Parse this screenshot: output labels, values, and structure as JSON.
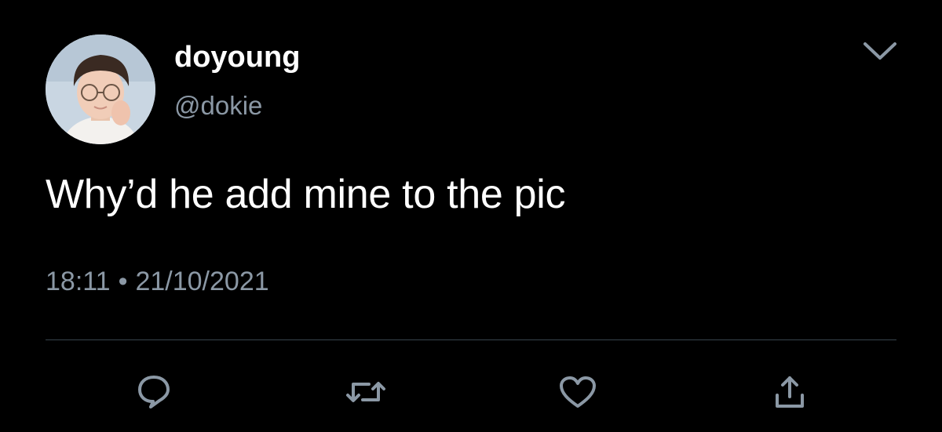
{
  "user": {
    "display_name": "doyoung",
    "handle": "@dokie",
    "avatar_icon": "profile-photo"
  },
  "tweet": {
    "text": "Why’d he add mine to the pic",
    "time": "18:11",
    "separator": "•",
    "date": "21/10/2021"
  },
  "actions": {
    "reply_icon": "reply-icon",
    "retweet_icon": "retweet-icon",
    "like_icon": "heart-icon",
    "share_icon": "share-icon",
    "menu_icon": "chevron-down-icon"
  },
  "colors": {
    "background": "#000000",
    "primary_text": "#ffffff",
    "secondary_text": "#8b98a5",
    "divider": "#38444d",
    "icon": "#8b98a5"
  }
}
